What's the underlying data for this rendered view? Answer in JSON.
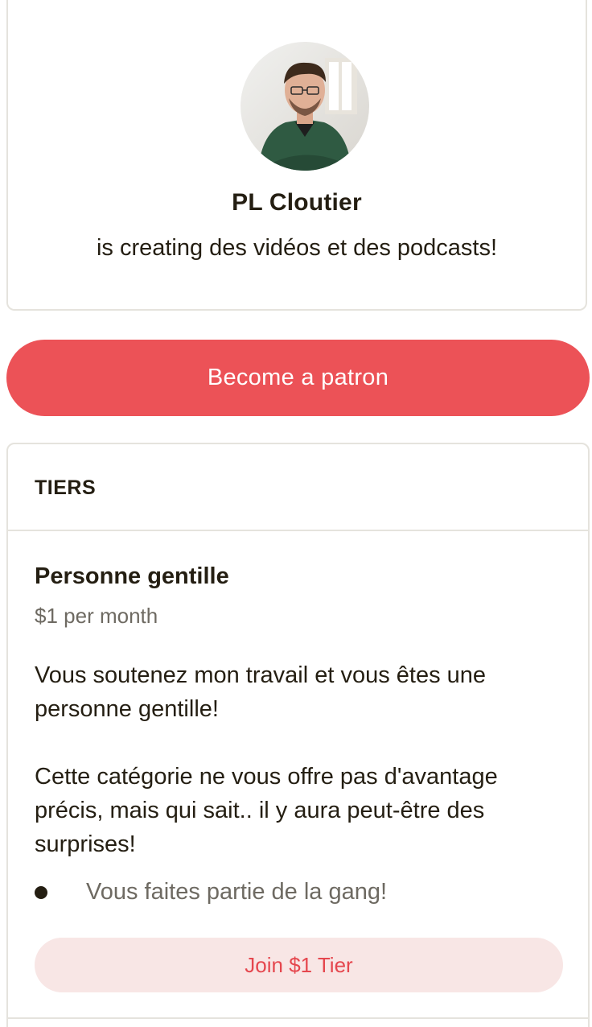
{
  "creator": {
    "name": "PL Cloutier",
    "tagline": "is creating des vidéos et des podcasts!"
  },
  "cta": {
    "become_label": "Become a patron"
  },
  "tiers": {
    "heading": "TIERS",
    "items": [
      {
        "name": "Personne gentille",
        "price": "$1 per month",
        "description": [
          "Vous soutenez mon travail et vous êtes une personne gentille!",
          "Cette catégorie ne vous offre pas d'avantage précis, mais qui sait.. il y aura peut-être des surprises!"
        ],
        "benefits": [
          "Vous faites partie de la gang!"
        ],
        "join_label": "Join $1 Tier"
      }
    ]
  },
  "colors": {
    "accent": "#ec5257",
    "join_bg": "#f8e6e5",
    "join_text": "#e5474e"
  }
}
